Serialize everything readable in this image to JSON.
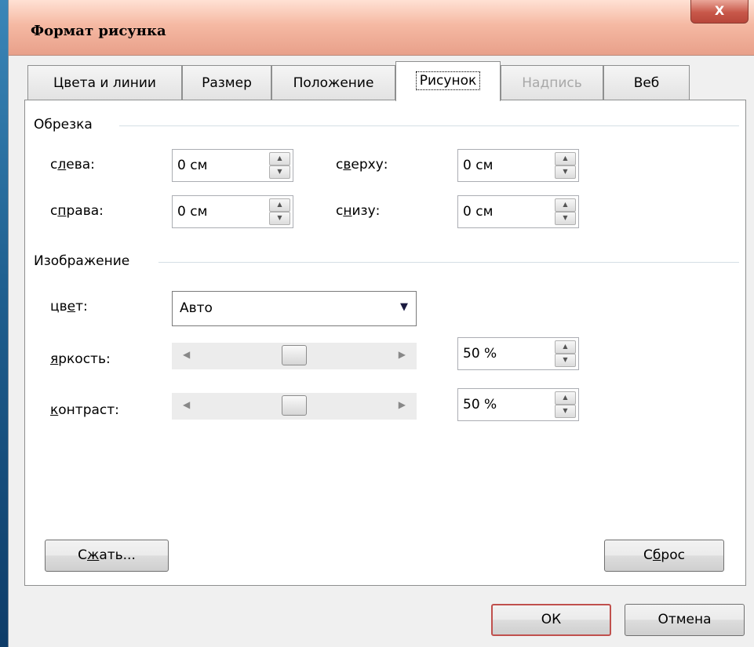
{
  "window": {
    "title": "Формат рисунка",
    "close_glyph": "X"
  },
  "tabs": [
    {
      "label": "Цвета и линии"
    },
    {
      "label": "Размер"
    },
    {
      "label": "Положение"
    },
    {
      "label": "Рисунок"
    },
    {
      "label": "Надпись"
    },
    {
      "label": "Веб"
    }
  ],
  "crop": {
    "group_label": "Обрезка",
    "left": {
      "label_pre": "с",
      "label_u": "л",
      "label_post": "ева:",
      "value": "0 см"
    },
    "top": {
      "label_pre": "с",
      "label_u": "в",
      "label_post": "ерху:",
      "value": "0 см"
    },
    "right": {
      "label_pre": "с",
      "label_u": "п",
      "label_post": "рава:",
      "value": "0 см"
    },
    "bottom": {
      "label_pre": "с",
      "label_u": "н",
      "label_post": "изу:",
      "value": "0 см"
    }
  },
  "image": {
    "group_label": "Изображение",
    "color": {
      "label_pre": "цв",
      "label_u": "е",
      "label_post": "т:",
      "value": "Авто"
    },
    "brightness": {
      "label_u": "я",
      "label_post": "ркость:",
      "value": "50 %",
      "level": 0.5
    },
    "contrast": {
      "label_u": "к",
      "label_post": "онтраст:",
      "value": "50 %",
      "level": 0.5
    }
  },
  "buttons": {
    "compress": {
      "pre": "С",
      "u": "ж",
      "post": "ать..."
    },
    "reset": {
      "pre": "С",
      "u": "б",
      "post": "рос"
    },
    "ok": "ОК",
    "cancel": "Отмена"
  },
  "icons": {
    "spin_up": "spin-up-arrow-icon",
    "spin_down": "spin-down-arrow-icon",
    "dropdown": "dropdown-caret-icon",
    "slider_left": "slider-left-arrow-icon",
    "slider_right": "slider-right-arrow-icon"
  },
  "colors": {
    "title_gradient_bottom": "#e8a08a",
    "close_button": "#c8584a",
    "ok_border": "#c0504d"
  }
}
